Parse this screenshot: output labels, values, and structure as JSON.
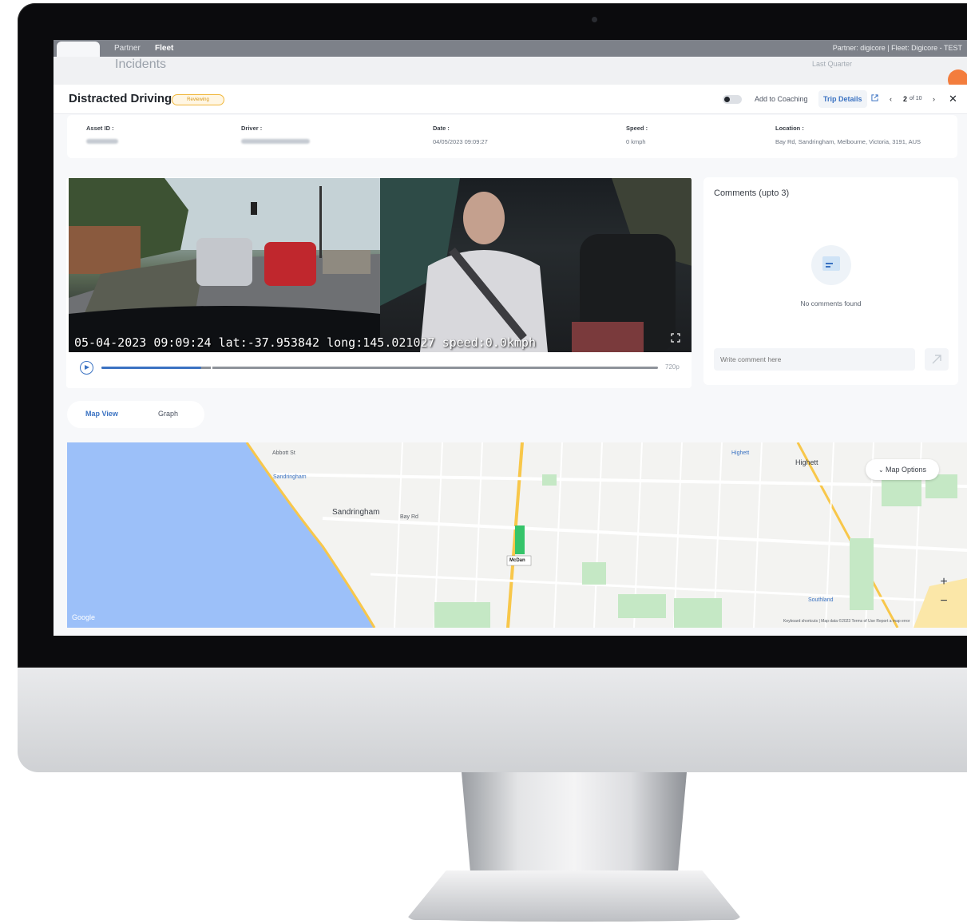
{
  "nav": {
    "partner_tab": "Partner",
    "fleet_tab": "Fleet",
    "account": "Partner: digicore  |  Fleet: Digicore - TEST"
  },
  "page": {
    "title": "Incidents",
    "period": "Last Quarter"
  },
  "incident": {
    "title": "Distracted Driving",
    "badge": "Reviewing",
    "add_to_coaching": "Add to Coaching",
    "trip_details": "Trip Details",
    "pager_current": "2",
    "pager_total": "of 10"
  },
  "info": {
    "asset_label": "Asset ID :",
    "driver_label": "Driver :",
    "date_label": "Date :",
    "date_value": "04/05/2023 09:09:27",
    "speed_label": "Speed :",
    "speed_value": "0 kmph",
    "location_label": "Location :",
    "location_value": "Bay Rd, Sandringham, Melbourne, Victoria, 3191, AUS"
  },
  "video": {
    "overlay": "05-04-2023 09:09:24 lat:-37.953842 long:145.021027 speed:0.0kmph",
    "quality": "720p",
    "progress": 0.18,
    "buffered": 0.62
  },
  "comments": {
    "title": "Comments (upto 3)",
    "empty": "No comments found",
    "placeholder": "Write comment here"
  },
  "views": {
    "map_view": "Map View",
    "graph": "Graph"
  },
  "map": {
    "options": "Map Options",
    "zoom_in": "+",
    "zoom_out": "−",
    "attribution": "Keyboard shortcuts | Map data ©2023  Terms of Use  Report a map error",
    "google": "Google",
    "marker": "McDan",
    "labels": {
      "sandringham": "Sandringham",
      "highett": "Highett",
      "abbott_st": "Abbott St",
      "bay_rd": "Bay Rd",
      "southland": "Southland",
      "sandringham_station": "Sandringham",
      "highett_station": "Highett"
    }
  },
  "colors": {
    "accent": "#3a72c2",
    "water": "#9cc0f9",
    "park": "#c5e8c5",
    "road_major": "#f8c74a",
    "badge": "#f0b73c"
  }
}
